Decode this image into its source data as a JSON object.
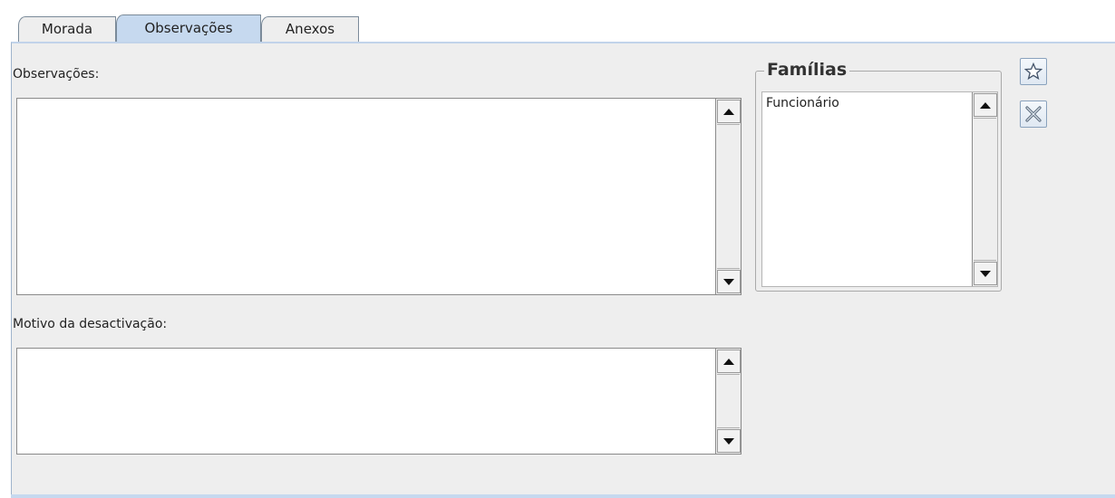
{
  "tabs": [
    {
      "label": "Morada",
      "active": false
    },
    {
      "label": "Observações",
      "active": true
    },
    {
      "label": "Anexos",
      "active": false
    }
  ],
  "observacoes": {
    "label": "Observações:",
    "value": ""
  },
  "motivo": {
    "label": "Motivo da desactivação:",
    "value": ""
  },
  "familias": {
    "title": "Famílias",
    "items": [
      "Funcionário"
    ],
    "add_icon": "star-icon",
    "remove_icon": "close-x-icon"
  },
  "colors": {
    "active_tab": "#c6d9ef",
    "panel_bg": "#eeeeee"
  }
}
